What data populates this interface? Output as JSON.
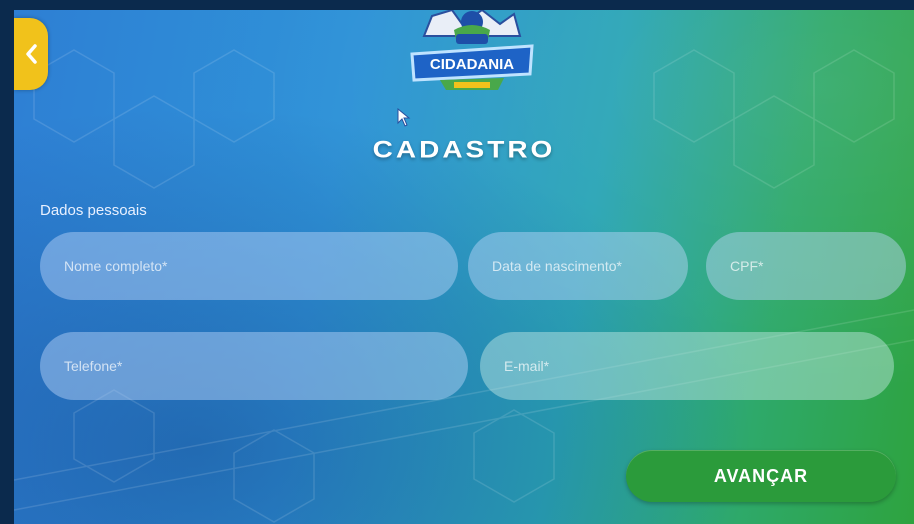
{
  "header": {
    "logo_text": "CIDADANIA",
    "title": "CADASTRO"
  },
  "form": {
    "section_label": "Dados pessoais",
    "fields": {
      "nome": "Nome completo*",
      "nascimento": "Data de nascimento*",
      "cpf": "CPF*",
      "telefone": "Telefone*",
      "email": "E-mail*"
    },
    "submit_label": "AVANÇAR"
  },
  "colors": {
    "back_button": "#f1c21b",
    "submit_button": "#2b9b3b"
  }
}
